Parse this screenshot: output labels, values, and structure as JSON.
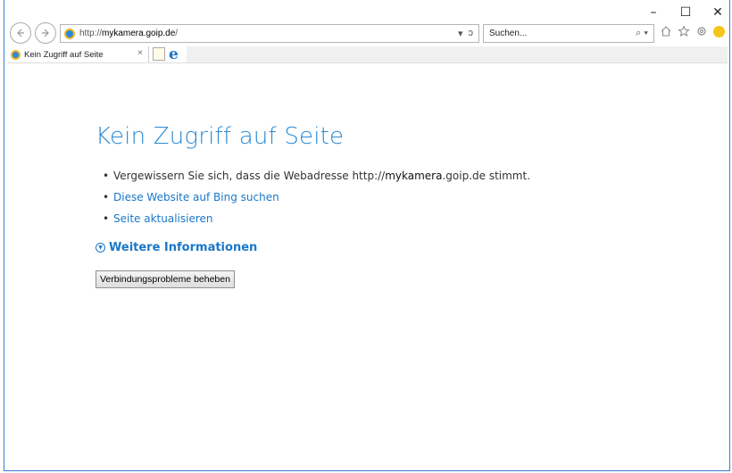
{
  "window": {
    "minimize": "–",
    "maximize": "☐",
    "close": "✕"
  },
  "nav": {
    "back_icon": "arrow-left-icon",
    "forward_icon": "arrow-right-icon",
    "url_prefix": "http://",
    "url_host": "mykamera.goip.de",
    "url_suffix": "/",
    "dropdown_glyph": "▾",
    "refresh_glyph": "ↄ",
    "search_placeholder": "Suchen...",
    "search_glyph": "⌕ ▾"
  },
  "tabs": [
    {
      "label": "Kein Zugriff auf Seite",
      "close": "×"
    }
  ],
  "page": {
    "title": "Kein Zugriff auf Seite",
    "hint1_pre": "Vergewissern Sie sich, dass die Webadresse http://",
    "hint1_host": "mykamera",
    "hint1_post": ".goip.de stimmt.",
    "hint2": "Diese Website auf Bing suchen",
    "hint3": "Seite aktualisieren",
    "more_info": "Weitere Informationen",
    "fix_button": "Verbindungsprobleme beheben"
  },
  "colors": {
    "accent": "#2b8ad4",
    "link": "#1a77c9"
  }
}
